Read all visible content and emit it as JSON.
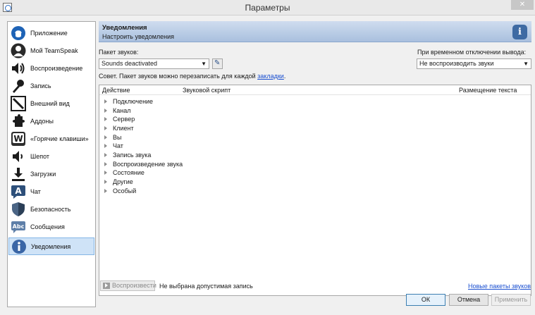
{
  "window": {
    "title": "Параметры",
    "close_glyph": "✕"
  },
  "sidebar": {
    "items": [
      {
        "label": "Приложение",
        "icon": "app-icon"
      },
      {
        "label": "Мой TeamSpeak",
        "icon": "profile-icon"
      },
      {
        "label": "Воспроизведение",
        "icon": "speaker-icon"
      },
      {
        "label": "Запись",
        "icon": "microphone-icon"
      },
      {
        "label": "Внешний вид",
        "icon": "appearance-icon"
      },
      {
        "label": "Аддоны",
        "icon": "puzzle-icon"
      },
      {
        "label": "«Горячие клавиши»",
        "icon": "hotkey-icon"
      },
      {
        "label": "Шепот",
        "icon": "whisper-icon"
      },
      {
        "label": "Загрузки",
        "icon": "download-icon"
      },
      {
        "label": "Чат",
        "icon": "chat-icon"
      },
      {
        "label": "Безопасность",
        "icon": "shield-icon"
      },
      {
        "label": "Сообщения",
        "icon": "messages-icon"
      },
      {
        "label": "Уведомления",
        "icon": "info-icon"
      }
    ],
    "active_index": 12
  },
  "header": {
    "title": "Уведомления",
    "subtitle": "Настроить уведомления",
    "info_glyph": "i"
  },
  "sound_pack": {
    "label": "Пакет звуков:",
    "value": "Sounds deactivated",
    "arrow": "▼"
  },
  "mute_output": {
    "label": "При временном отключении вывода:",
    "value": "Не воспроизводить звуки",
    "arrow": "▼"
  },
  "tip": {
    "text": "Совет. Пакет звуков можно перезаписать для каждой ",
    "link": "закладки",
    "suffix": "."
  },
  "tree": {
    "columns": [
      "Действие",
      "Звуковой скрипт",
      "Размещение текста"
    ],
    "items": [
      "Подключение",
      "Канал",
      "Сервер",
      "Клиент",
      "Вы",
      "Чат",
      "Запись звука",
      "Воспроизведение звука",
      "Состояние",
      "Другие",
      "Особый"
    ]
  },
  "footer": {
    "play_label": "Воспроизвести",
    "status": "Не выбрана допустимая запись",
    "new_packs_link": "Новые пакеты звуков",
    "ok": "ОК",
    "cancel": "Отмена",
    "apply": "Применить"
  }
}
